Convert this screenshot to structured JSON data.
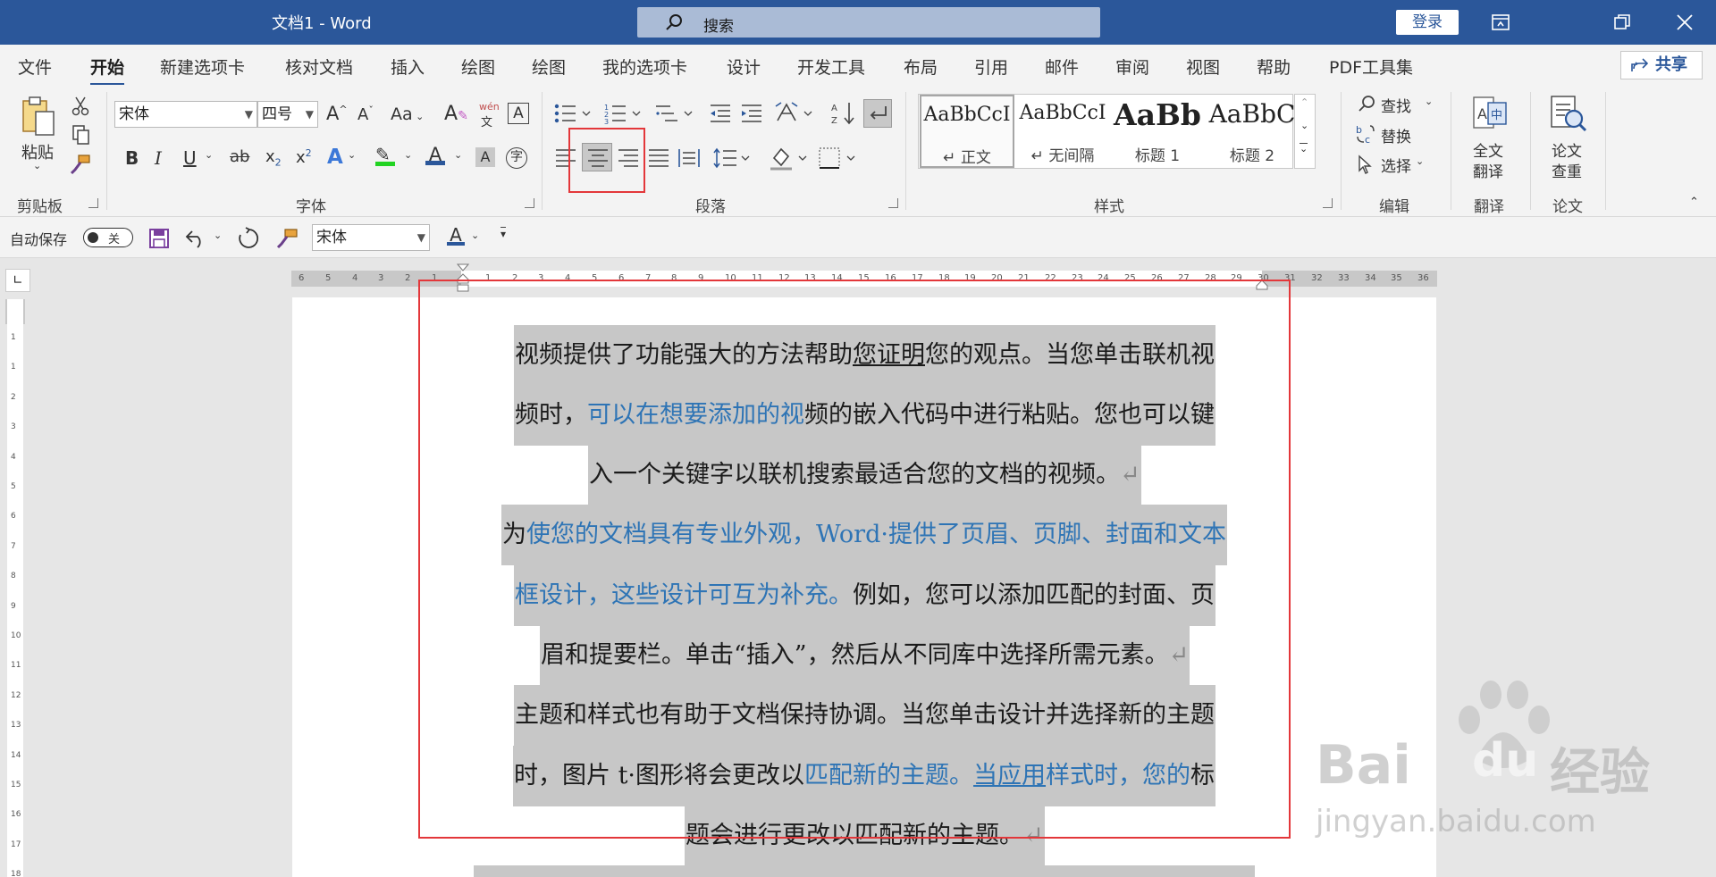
{
  "titlebar": {
    "title": "文档1  -  Word",
    "search_placeholder": "搜索",
    "login": "登录"
  },
  "menu": {
    "tabs": [
      "文件",
      "开始",
      "新建选项卡",
      "核对文档",
      "插入",
      "绘图",
      "绘图",
      "我的选项卡",
      "设计",
      "开发工具",
      "布局",
      "引用",
      "邮件",
      "审阅",
      "视图",
      "帮助",
      "PDF工具集"
    ],
    "active_index": 1,
    "share": "共享"
  },
  "ribbon": {
    "clipboard": {
      "paste": "粘贴",
      "group": "剪贴板"
    },
    "font": {
      "name": "宋体",
      "size": "四号",
      "group": "字体",
      "grow": "A",
      "shrink": "A",
      "case": "Aa",
      "phonetic": "wén",
      "bold": "B",
      "italic": "I",
      "underline": "U",
      "strike": "ab",
      "sub": "x",
      "sup": "x"
    },
    "paragraph": {
      "group": "段落"
    },
    "styles": {
      "group": "样式",
      "items": [
        {
          "preview": "AaBbCcI",
          "name": "↵ 正文"
        },
        {
          "preview": "AaBbCcI",
          "name": "↵ 无间隔"
        },
        {
          "preview": "AaBb",
          "name": "标题 1"
        },
        {
          "preview": "AaBbC",
          "name": "标题 2"
        }
      ]
    },
    "editing": {
      "find": "查找",
      "replace": "替换",
      "select": "选择",
      "group": "编辑"
    },
    "translate": {
      "full": "全文",
      "translate": "翻译",
      "group": "翻译"
    },
    "paper": {
      "paper": "论文",
      "check": "查重",
      "group": "论文"
    }
  },
  "qat": {
    "autosave": "自动保存",
    "toggle": "关",
    "font": "宋体"
  },
  "ruler": {
    "h_labels": [
      "6",
      "5",
      "4",
      "3",
      "2",
      "1",
      "",
      "1",
      "2",
      "3",
      "4",
      "5",
      "6",
      "7",
      "8",
      "9",
      "10",
      "11",
      "12",
      "13",
      "14",
      "15",
      "16",
      "17",
      "18",
      "19",
      "20",
      "21",
      "22",
      "23",
      "24",
      "25",
      "26",
      "27",
      "28",
      "29",
      "30",
      "31",
      "32",
      "33",
      "34",
      "35",
      "36"
    ],
    "v_labels": [
      "1",
      "1",
      "2",
      "3",
      "4",
      "5",
      "6",
      "7",
      "8",
      "9",
      "10",
      "11",
      "12",
      "13",
      "14",
      "15",
      "16",
      "17",
      "18"
    ]
  },
  "document": {
    "lines": [
      [
        {
          "t": "视频提供了功能强大的方法帮助"
        },
        {
          "t": "您证明",
          "u": 1
        },
        {
          "t": "您的观点。当您单击联机视"
        }
      ],
      [
        {
          "t": "频时，"
        },
        {
          "t": "可以在想要添加的视",
          "b": 1
        },
        {
          "t": "频的嵌入代码中进行粘贴。您也可以键"
        }
      ],
      [
        {
          "t": "入一个关键字以联机搜索最适合您的文档的视频。"
        },
        {
          "t": "↵",
          "p": 1
        }
      ],
      [
        {
          "t": "为"
        },
        {
          "t": "使您的文档具有专业外观，Word·提供了页眉、页脚、封面和文本",
          "b": 1
        }
      ],
      [
        {
          "t": "框设计，这些设计可互为补充。",
          "b": 1
        },
        {
          "t": "例如，您可以添加匹配的封面、页"
        }
      ],
      [
        {
          "t": "眉和提要栏。单击“插入”，然后从不同库中选择所需元素。"
        },
        {
          "t": "↵",
          "p": 1
        }
      ],
      [
        {
          "t": "主题和样式也有助于文档保持协调。当您单击设计并选择新的主题"
        }
      ],
      [
        {
          "t": "时，图片 t·图形将会更改以"
        },
        {
          "t": "匹配新的主题。",
          "b": 1
        },
        {
          "t": "当应用",
          "b": 1,
          "u": 1
        },
        {
          "t": "样式时，您的",
          "b": 1
        },
        {
          "t": "标"
        }
      ],
      [
        {
          "t": "题会进行更改以匹配新的主题。"
        },
        {
          "t": "↵",
          "p": 1
        }
      ]
    ]
  },
  "watermark": {
    "brand": "Bai",
    "brand2": "du",
    "cn": "经验",
    "url": "jingyan.baidu.com"
  }
}
